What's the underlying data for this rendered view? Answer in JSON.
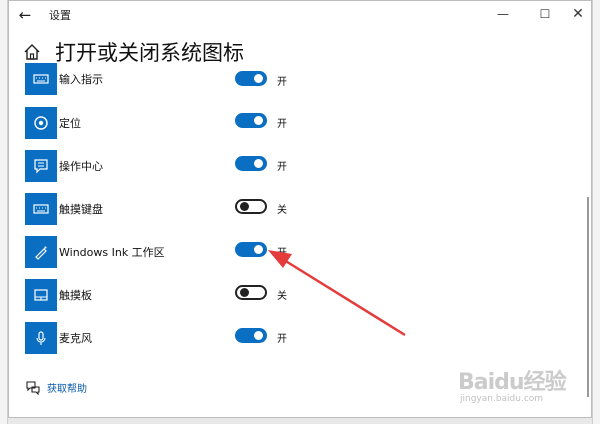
{
  "window": {
    "title": "设置"
  },
  "page": {
    "title": "打开或关闭系统图标"
  },
  "items": [
    {
      "label": "输入指示",
      "state": "开",
      "on": true,
      "icon": "keyboard-icon"
    },
    {
      "label": "定位",
      "state": "开",
      "on": true,
      "icon": "location-icon"
    },
    {
      "label": "操作中心",
      "state": "开",
      "on": true,
      "icon": "action-center-icon"
    },
    {
      "label": "触摸键盘",
      "state": "关",
      "on": false,
      "icon": "touch-keyboard-icon"
    },
    {
      "label": "Windows Ink 工作区",
      "state": "开",
      "on": true,
      "icon": "pen-icon"
    },
    {
      "label": "触摸板",
      "state": "关",
      "on": false,
      "icon": "touchpad-icon"
    },
    {
      "label": "麦克风",
      "state": "开",
      "on": true,
      "icon": "microphone-icon"
    }
  ],
  "help": {
    "label": "获取帮助"
  },
  "watermark": {
    "brand": "Baidu经验",
    "url": "jingyan.baidu.com"
  },
  "colors": {
    "accent": "#0a6fc2",
    "link": "#0a5aa8",
    "annotation": "#e53b3b"
  }
}
